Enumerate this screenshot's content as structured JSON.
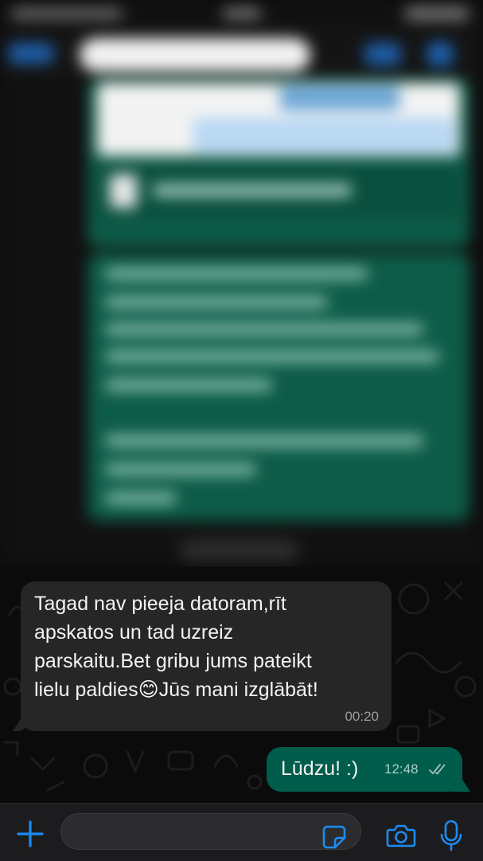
{
  "incoming_message": {
    "text": "Tagad nav pieeja datoram,rīt\napskatos un tad uzreiz\nparskaitu.Bet gribu jums pateikt\nlielu paldies😊Jūs mani izglābāt!",
    "time": "00:20"
  },
  "outgoing_message": {
    "text": "Lūdzu! :)",
    "time": "12:48",
    "status": "read"
  },
  "input_bar": {
    "placeholder": ""
  },
  "icons": {
    "add": "plus-icon",
    "sticker": "sticker-icon",
    "camera": "camera-icon",
    "mic": "microphone-icon",
    "read_receipt": "double-check-icon"
  },
  "colors": {
    "accent": "#1c8cf2",
    "incoming_bubble": "#262626",
    "outgoing_bubble": "#005c4b",
    "background": "#0b0b0b"
  }
}
